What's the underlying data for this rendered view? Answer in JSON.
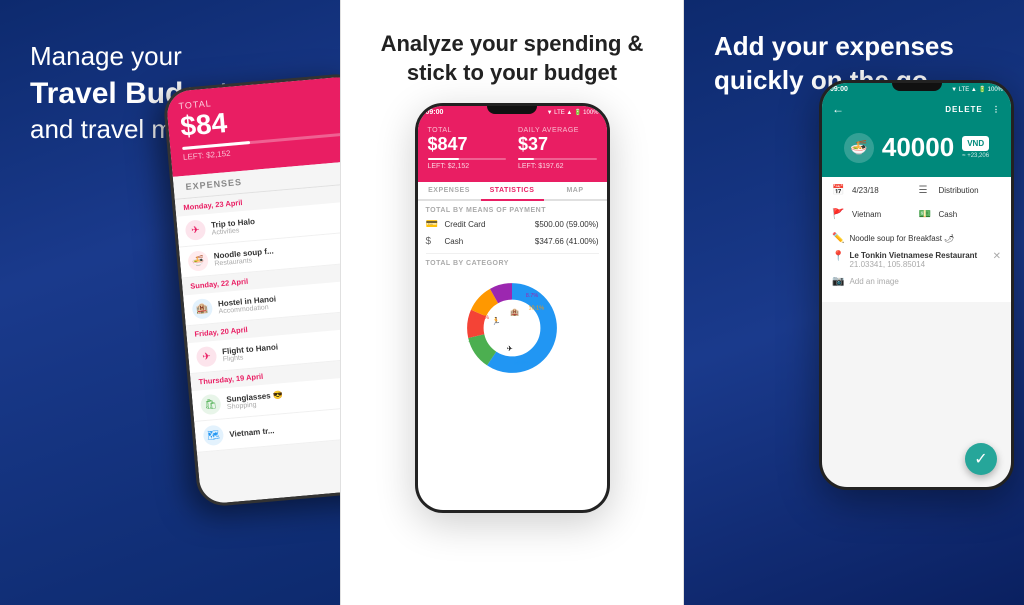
{
  "panel1": {
    "headline_line1": "Manage your",
    "headline_bold": "Travel Budget",
    "headline_line3": "and travel more",
    "phone": {
      "total_label": "TOTAL",
      "amount": "$84",
      "left_label": "LEFT: $2,152",
      "expenses_label": "EXPENSES",
      "date1": "Monday, 23 April",
      "item1_name": "Trip to Halo",
      "item1_cat": "Activities",
      "item2_name": "Noodle soup f...",
      "item2_cat": "Restaurants",
      "date2": "Sunday, 22 April",
      "item3_name": "Hostel in Hanoi",
      "item3_cat": "Accommodation",
      "date3": "Friday, 20 April",
      "item4_name": "Flight to Hanoi",
      "item4_cat": "Flights",
      "date4": "Thursday, 19 April",
      "item5_name": "Sunglasses 😎",
      "item5_cat": "Shopping",
      "item6_name": "Vietnam tr..."
    }
  },
  "panel2": {
    "headline": "Analyze your spending & stick to your budget",
    "phone": {
      "time": "09:00",
      "status_icons": "▼ LTE ▲ 🔋 100%",
      "total_label": "TOTAL",
      "total_amount": "$847",
      "daily_label": "DAILY AVERAGE",
      "daily_amount": "$37",
      "total_left": "LEFT: $2,152",
      "daily_left": "LEFT: $197.62",
      "tab_expenses": "EXPENSES",
      "tab_statistics": "STATISTICS",
      "tab_map": "MAP",
      "section_payment": "TOTAL BY MEANS OF PAYMENT",
      "credit_card_label": "Credit Card",
      "credit_card_amount": "$500.00 (59.00%)",
      "cash_label": "Cash",
      "cash_amount": "$347.66 (41.00%)",
      "section_category": "TOTAL BY CATEGORY",
      "chart": {
        "segments": [
          {
            "label": "Accommodation",
            "value": 59.0,
            "color": "#2196f3"
          },
          {
            "label": "Flights",
            "value": 12.0,
            "color": "#4caf50"
          },
          {
            "label": "Restaurants",
            "value": 10.2,
            "color": "#f44336"
          },
          {
            "label": "Activities",
            "value": 10.1,
            "color": "#ff9800"
          },
          {
            "label": "Shopping",
            "value": 8.7,
            "color": "#9c27b0"
          }
        ],
        "labels": [
          "8.7%",
          "10.1%",
          "10.2%",
          "12.0%",
          "59.0%"
        ]
      }
    }
  },
  "panel3": {
    "headline_line1": "Add your expenses",
    "headline_line2": "quickly on the go",
    "phone": {
      "time": "09:00",
      "status_icons": "▼ LTE ▲ 🔋 100%",
      "delete_label": "DELETE",
      "more_icon": "⋮",
      "amount": "40000",
      "currency": "VND",
      "currency_sub": "≈ +23,206",
      "food_icon": "🍜",
      "date_label": "4/23/18",
      "distribution_label": "Distribution",
      "country_label": "Vietnam",
      "payment_label": "Cash",
      "noodle_text": "Noodle soup for Breakfast 🌶",
      "location_name": "Le Tonkin Vietnamese Restaurant",
      "location_coords": "21.03341, 105.85014",
      "add_image": "Add an image",
      "fab_icon": "✓"
    }
  }
}
